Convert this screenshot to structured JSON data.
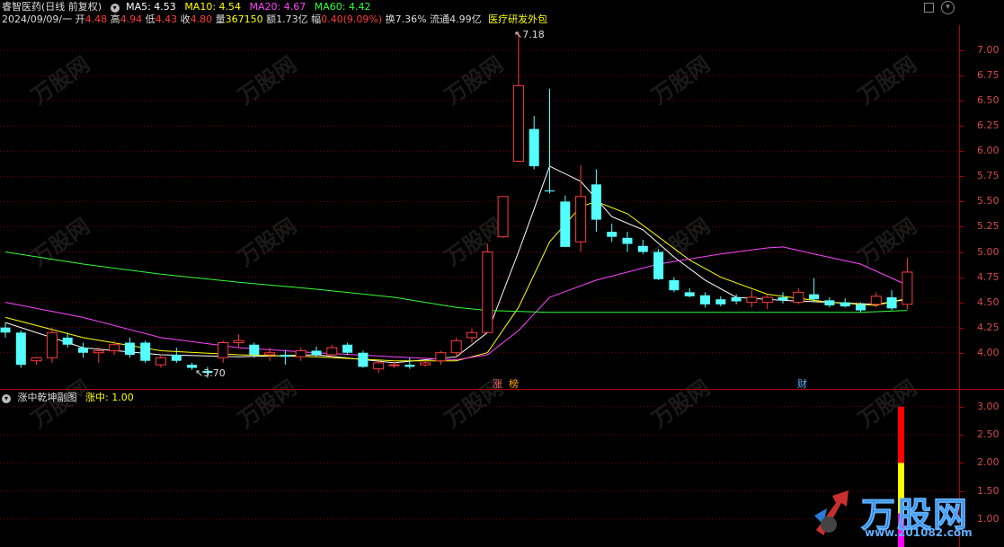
{
  "header": {
    "stock_title": "睿智医药(日线 前复权)",
    "ma_labels": [
      {
        "text": "MA5: 4.53",
        "color": "#ffffff"
      },
      {
        "text": "MA10: 4.54",
        "color": "#ffff00"
      },
      {
        "text": "MA20: 4.67",
        "color": "#ff44ff"
      },
      {
        "text": "MA60: 4.42",
        "color": "#33ff33"
      }
    ],
    "date": "2024/09/09/一",
    "open_label": "开",
    "open": "4.48",
    "high_label": "高",
    "high": "4.94",
    "low_label": "低",
    "low": "4.43",
    "close_label": "收",
    "close": "4.80",
    "volume_label": "量",
    "volume": "367150",
    "amount_label": "额",
    "amount": "1.73亿",
    "range_label": "幅",
    "range": "0.40(9.09%)",
    "turnover_label": "换",
    "turnover": "7.36%",
    "float_label": "流通",
    "float_cap": "4.99亿",
    "sector": "医疗研发外包"
  },
  "price_axis": [
    "7.00",
    "6.75",
    "6.50",
    "6.25",
    "6.00",
    "5.75",
    "5.50",
    "5.25",
    "5.00",
    "4.75",
    "4.50",
    "4.25",
    "4.00"
  ],
  "annotations": {
    "high_mark": "7.18",
    "low_mark": "3.70",
    "tag_zhang": "涨",
    "tag_bang": "榜",
    "tag_cai": "财"
  },
  "sub_panel": {
    "title": "涨中乾坤副图",
    "indicator": "涨中: 1.00",
    "axis": [
      "3.00",
      "2.50",
      "2.00",
      "1.50",
      "1.00"
    ]
  },
  "watermark": {
    "brand": "万股网",
    "url": "www.201082.com"
  },
  "chart_data": {
    "type": "candlestick",
    "title": "睿智医药(日线 前复权)",
    "ylim": [
      3.65,
      7.25
    ],
    "up_color": "#ff3b3b",
    "down_color": "#54ffff",
    "candles": [
      [
        4.25,
        4.3,
        4.15,
        4.2
      ],
      [
        4.2,
        4.22,
        3.85,
        3.88
      ],
      [
        3.92,
        3.96,
        3.88,
        3.95
      ],
      [
        3.95,
        4.25,
        3.9,
        4.2
      ],
      [
        4.15,
        4.2,
        4.05,
        4.08
      ],
      [
        4.05,
        4.1,
        3.95,
        4.0
      ],
      [
        4.0,
        4.05,
        3.9,
        4.02
      ],
      [
        4.02,
        4.12,
        3.98,
        4.08
      ],
      [
        4.1,
        4.15,
        3.95,
        3.98
      ],
      [
        4.1,
        4.12,
        3.9,
        3.92
      ],
      [
        3.88,
        3.98,
        3.85,
        3.95
      ],
      [
        3.98,
        4.05,
        3.9,
        3.92
      ],
      [
        3.88,
        3.9,
        3.83,
        3.85
      ],
      [
        3.82,
        3.86,
        3.75,
        3.8
      ],
      [
        3.95,
        4.12,
        3.9,
        4.1
      ],
      [
        4.1,
        4.18,
        4.05,
        4.12
      ],
      [
        4.08,
        4.1,
        3.95,
        3.98
      ],
      [
        3.98,
        4.05,
        3.92,
        4.0
      ],
      [
        3.98,
        4.02,
        3.88,
        3.96
      ],
      [
        3.96,
        4.05,
        3.92,
        4.02
      ],
      [
        4.02,
        4.06,
        3.96,
        3.98
      ],
      [
        3.98,
        4.08,
        3.95,
        4.05
      ],
      [
        4.08,
        4.1,
        3.98,
        4.0
      ],
      [
        4.0,
        4.02,
        3.85,
        3.86
      ],
      [
        3.84,
        3.92,
        3.8,
        3.9
      ],
      [
        3.88,
        3.92,
        3.85,
        3.88
      ],
      [
        3.88,
        3.95,
        3.84,
        3.86
      ],
      [
        3.88,
        3.92,
        3.86,
        3.9
      ],
      [
        3.92,
        4.02,
        3.88,
        4.0
      ],
      [
        4.0,
        4.15,
        3.95,
        4.12
      ],
      [
        4.15,
        4.24,
        4.1,
        4.2
      ],
      [
        4.2,
        5.08,
        4.2,
        5.0
      ],
      [
        5.15,
        5.55,
        5.14,
        5.55
      ],
      [
        5.9,
        7.18,
        5.9,
        6.65
      ],
      [
        6.22,
        6.35,
        5.82,
        5.85
      ],
      [
        5.61,
        6.62,
        5.58,
        5.6
      ],
      [
        5.5,
        5.56,
        5.05,
        5.05
      ],
      [
        5.1,
        5.86,
        5.0,
        5.55
      ],
      [
        5.67,
        5.82,
        5.2,
        5.32
      ],
      [
        5.2,
        5.28,
        5.1,
        5.15
      ],
      [
        5.14,
        5.2,
        5.0,
        5.08
      ],
      [
        5.06,
        5.12,
        4.98,
        5.0
      ],
      [
        5.0,
        5.03,
        4.72,
        4.73
      ],
      [
        4.72,
        4.75,
        4.6,
        4.62
      ],
      [
        4.6,
        4.64,
        4.55,
        4.56
      ],
      [
        4.57,
        4.6,
        4.45,
        4.48
      ],
      [
        4.53,
        4.56,
        4.46,
        4.48
      ],
      [
        4.55,
        4.58,
        4.48,
        4.51
      ],
      [
        4.5,
        4.62,
        4.45,
        4.55
      ],
      [
        4.5,
        4.58,
        4.43,
        4.55
      ],
      [
        4.55,
        4.6,
        4.49,
        4.52
      ],
      [
        4.5,
        4.64,
        4.48,
        4.6
      ],
      [
        4.58,
        4.74,
        4.5,
        4.53
      ],
      [
        4.52,
        4.55,
        4.45,
        4.47
      ],
      [
        4.5,
        4.54,
        4.45,
        4.46
      ],
      [
        4.48,
        4.5,
        4.4,
        4.42
      ],
      [
        4.48,
        4.6,
        4.45,
        4.56
      ],
      [
        4.55,
        4.62,
        4.42,
        4.44
      ],
      [
        4.48,
        4.94,
        4.43,
        4.8
      ]
    ],
    "ma": [
      {
        "name": "MA5",
        "color": "#ffffff",
        "points": [
          [
            0,
            4.3
          ],
          [
            5,
            4.05
          ],
          [
            10,
            3.98
          ],
          [
            15,
            3.96
          ],
          [
            20,
            3.98
          ],
          [
            25,
            3.9
          ],
          [
            29,
            3.96
          ],
          [
            31,
            4.2
          ],
          [
            33,
            5.0
          ],
          [
            35,
            5.85
          ],
          [
            37,
            5.7
          ],
          [
            39,
            5.35
          ],
          [
            41,
            5.22
          ],
          [
            43,
            4.95
          ],
          [
            45,
            4.72
          ],
          [
            47,
            4.55
          ],
          [
            50,
            4.52
          ],
          [
            53,
            4.5
          ],
          [
            56,
            4.48
          ],
          [
            58,
            4.53
          ]
        ]
      },
      {
        "name": "MA10",
        "color": "#ffff00",
        "points": [
          [
            0,
            4.35
          ],
          [
            5,
            4.15
          ],
          [
            10,
            4.02
          ],
          [
            15,
            3.98
          ],
          [
            20,
            3.96
          ],
          [
            25,
            3.92
          ],
          [
            29,
            3.92
          ],
          [
            31,
            4.0
          ],
          [
            33,
            4.45
          ],
          [
            35,
            5.1
          ],
          [
            37,
            5.45
          ],
          [
            38,
            5.5
          ],
          [
            40,
            5.38
          ],
          [
            42,
            5.15
          ],
          [
            44,
            4.92
          ],
          [
            46,
            4.75
          ],
          [
            49,
            4.58
          ],
          [
            53,
            4.5
          ],
          [
            56,
            4.47
          ],
          [
            58,
            4.54
          ]
        ]
      },
      {
        "name": "MA20",
        "color": "#ff44ff",
        "points": [
          [
            0,
            4.5
          ],
          [
            5,
            4.35
          ],
          [
            10,
            4.15
          ],
          [
            15,
            4.05
          ],
          [
            20,
            4.0
          ],
          [
            25,
            3.96
          ],
          [
            29,
            3.93
          ],
          [
            31,
            3.98
          ],
          [
            33,
            4.22
          ],
          [
            35,
            4.55
          ],
          [
            38,
            4.72
          ],
          [
            42,
            4.88
          ],
          [
            46,
            4.98
          ],
          [
            49,
            5.04
          ],
          [
            50,
            5.05
          ],
          [
            52,
            4.98
          ],
          [
            55,
            4.88
          ],
          [
            58,
            4.67
          ]
        ]
      },
      {
        "name": "MA60",
        "color": "#33ff33",
        "points": [
          [
            0,
            5.0
          ],
          [
            5,
            4.88
          ],
          [
            10,
            4.78
          ],
          [
            15,
            4.7
          ],
          [
            20,
            4.63
          ],
          [
            25,
            4.55
          ],
          [
            29,
            4.45
          ],
          [
            31,
            4.42
          ],
          [
            35,
            4.4
          ],
          [
            45,
            4.4
          ],
          [
            55,
            4.4
          ],
          [
            58,
            4.42
          ]
        ]
      }
    ],
    "sub_indicator": {
      "name": "涨中",
      "value": 1.0,
      "ylim": [
        0.5,
        3.3
      ],
      "bar": [
        {
          "from": 0.5,
          "to": 1.1,
          "color": "#ff00ff"
        },
        {
          "from": 1.1,
          "to": 2.0,
          "color": "#ffff00"
        },
        {
          "from": 2.0,
          "to": 3.0,
          "color": "#ff0000"
        }
      ]
    }
  }
}
